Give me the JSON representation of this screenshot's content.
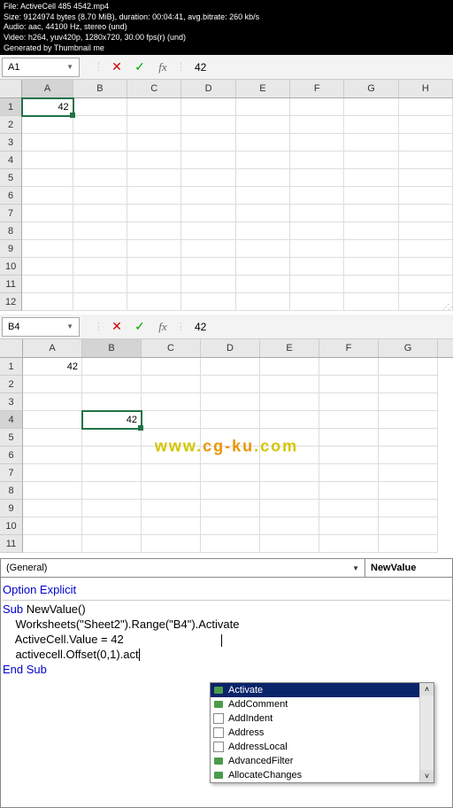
{
  "video_info": {
    "line1": "File: ActiveCell 485 4542.mp4",
    "line2": "Size: 9124974 bytes (8.70 MiB), duration: 00:04:41, avg.bitrate: 260 kb/s",
    "line3": "Audio: aac, 44100 Hz, stereo (und)",
    "line4": "Video: h264, yuv420p, 1280x720, 30.00 fps(r) (und)",
    "line5": "Generated by Thumbnail me"
  },
  "sheet1": {
    "name_box": "A1",
    "formula": "42",
    "cols": [
      "A",
      "B",
      "C",
      "D",
      "E",
      "F",
      "G",
      "H"
    ],
    "rows": [
      "1",
      "2",
      "3",
      "4",
      "5",
      "6",
      "7",
      "8",
      "9",
      "10",
      "11",
      "12"
    ],
    "a1": "42"
  },
  "sheet2": {
    "name_box": "B4",
    "formula": "42",
    "cols": [
      "A",
      "B",
      "C",
      "D",
      "E",
      "F",
      "G"
    ],
    "rows": [
      "1",
      "2",
      "3",
      "4",
      "5",
      "6",
      "7",
      "8",
      "9",
      "10",
      "11"
    ],
    "a1": "42",
    "b4": "42"
  },
  "watermark": {
    "p1": "www.",
    "p2": "cg-ku",
    "p3": ".com"
  },
  "vbe": {
    "combo_left": "(General)",
    "combo_right": "NewValue",
    "code": {
      "l1": "Option Explicit",
      "l2": "",
      "l3": "Sub NewValue()",
      "l4": "",
      "l5": "    Worksheets(\"Sheet2\").Range(\"B4\").Activate",
      "l6": "    ActiveCell.Value = 42",
      "l7": "    activecell.Offset(0,1).act",
      "l8": "",
      "l9": "End Sub"
    },
    "intellisense": [
      {
        "label": "Activate",
        "kind": "method",
        "selected": true
      },
      {
        "label": "AddComment",
        "kind": "method"
      },
      {
        "label": "AddIndent",
        "kind": "prop"
      },
      {
        "label": "Address",
        "kind": "prop"
      },
      {
        "label": "AddressLocal",
        "kind": "prop"
      },
      {
        "label": "AdvancedFilter",
        "kind": "method"
      },
      {
        "label": "AllocateChanges",
        "kind": "method"
      }
    ]
  },
  "icons": {
    "dd": "▼",
    "cancel": "✕",
    "confirm": "✓",
    "fx": "fx",
    "up": "˄",
    "down": "˅"
  }
}
